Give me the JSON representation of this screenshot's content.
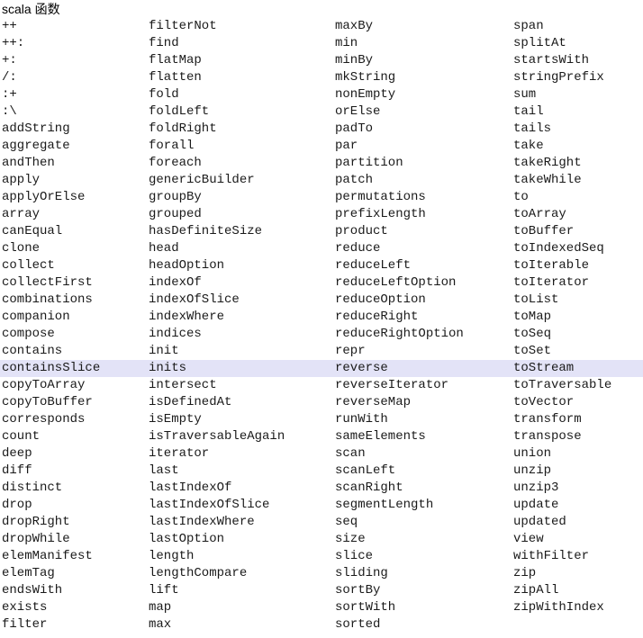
{
  "page": {
    "title": "scala 函数",
    "background_color": "#ffffff",
    "text_color": "#1a1a1a",
    "highlight_color": "#e3e3f7",
    "highlighted_row_index": 20
  },
  "columns": [
    {
      "name": "column-1",
      "items": [
        "++",
        "++:",
        "+:",
        "/:",
        ":+",
        ":\\",
        "addString",
        "aggregate",
        "andThen",
        "apply",
        "applyOrElse",
        "array",
        "canEqual",
        "clone",
        "collect",
        "collectFirst",
        "combinations",
        "companion",
        "compose",
        "contains",
        "containsSlice",
        "copyToArray",
        "copyToBuffer",
        "corresponds",
        "count",
        "deep",
        "diff",
        "distinct",
        "drop",
        "dropRight",
        "dropWhile",
        "elemManifest",
        "elemTag",
        "endsWith",
        "exists",
        "filter"
      ]
    },
    {
      "name": "column-2",
      "items": [
        "filterNot",
        "find",
        "flatMap",
        "flatten",
        "fold",
        "foldLeft",
        "foldRight",
        "forall",
        "foreach",
        "genericBuilder",
        "groupBy",
        "grouped",
        "hasDefiniteSize",
        "head",
        "headOption",
        "indexOf",
        "indexOfSlice",
        "indexWhere",
        "indices",
        "init",
        "inits",
        "intersect",
        "isDefinedAt",
        "isEmpty",
        "isTraversableAgain",
        "iterator",
        "last",
        "lastIndexOf",
        "lastIndexOfSlice",
        "lastIndexWhere",
        "lastOption",
        "length",
        "lengthCompare",
        "lift",
        "map",
        "max"
      ]
    },
    {
      "name": "column-3",
      "items": [
        "maxBy",
        "min",
        "minBy",
        "mkString",
        "nonEmpty",
        "orElse",
        "padTo",
        "par",
        "partition",
        "patch",
        "permutations",
        "prefixLength",
        "product",
        "reduce",
        "reduceLeft",
        "reduceLeftOption",
        "reduceOption",
        "reduceRight",
        "reduceRightOption",
        "repr",
        "reverse",
        "reverseIterator",
        "reverseMap",
        "runWith",
        "sameElements",
        "scan",
        "scanLeft",
        "scanRight",
        "segmentLength",
        "seq",
        "size",
        "slice",
        "sliding",
        "sortBy",
        "sortWith",
        "sorted"
      ]
    },
    {
      "name": "column-4",
      "items": [
        "span",
        "splitAt",
        "startsWith",
        "stringPrefix",
        "sum",
        "tail",
        "tails",
        "take",
        "takeRight",
        "takeWhile",
        "to",
        "toArray",
        "toBuffer",
        "toIndexedSeq",
        "toIterable",
        "toIterator",
        "toList",
        "toMap",
        "toSeq",
        "toSet",
        "toStream",
        "toTraversable",
        "toVector",
        "transform",
        "transpose",
        "union",
        "unzip",
        "unzip3",
        "update",
        "updated",
        "view",
        "withFilter",
        "zip",
        "zipAll",
        "zipWithIndex",
        ""
      ]
    }
  ]
}
